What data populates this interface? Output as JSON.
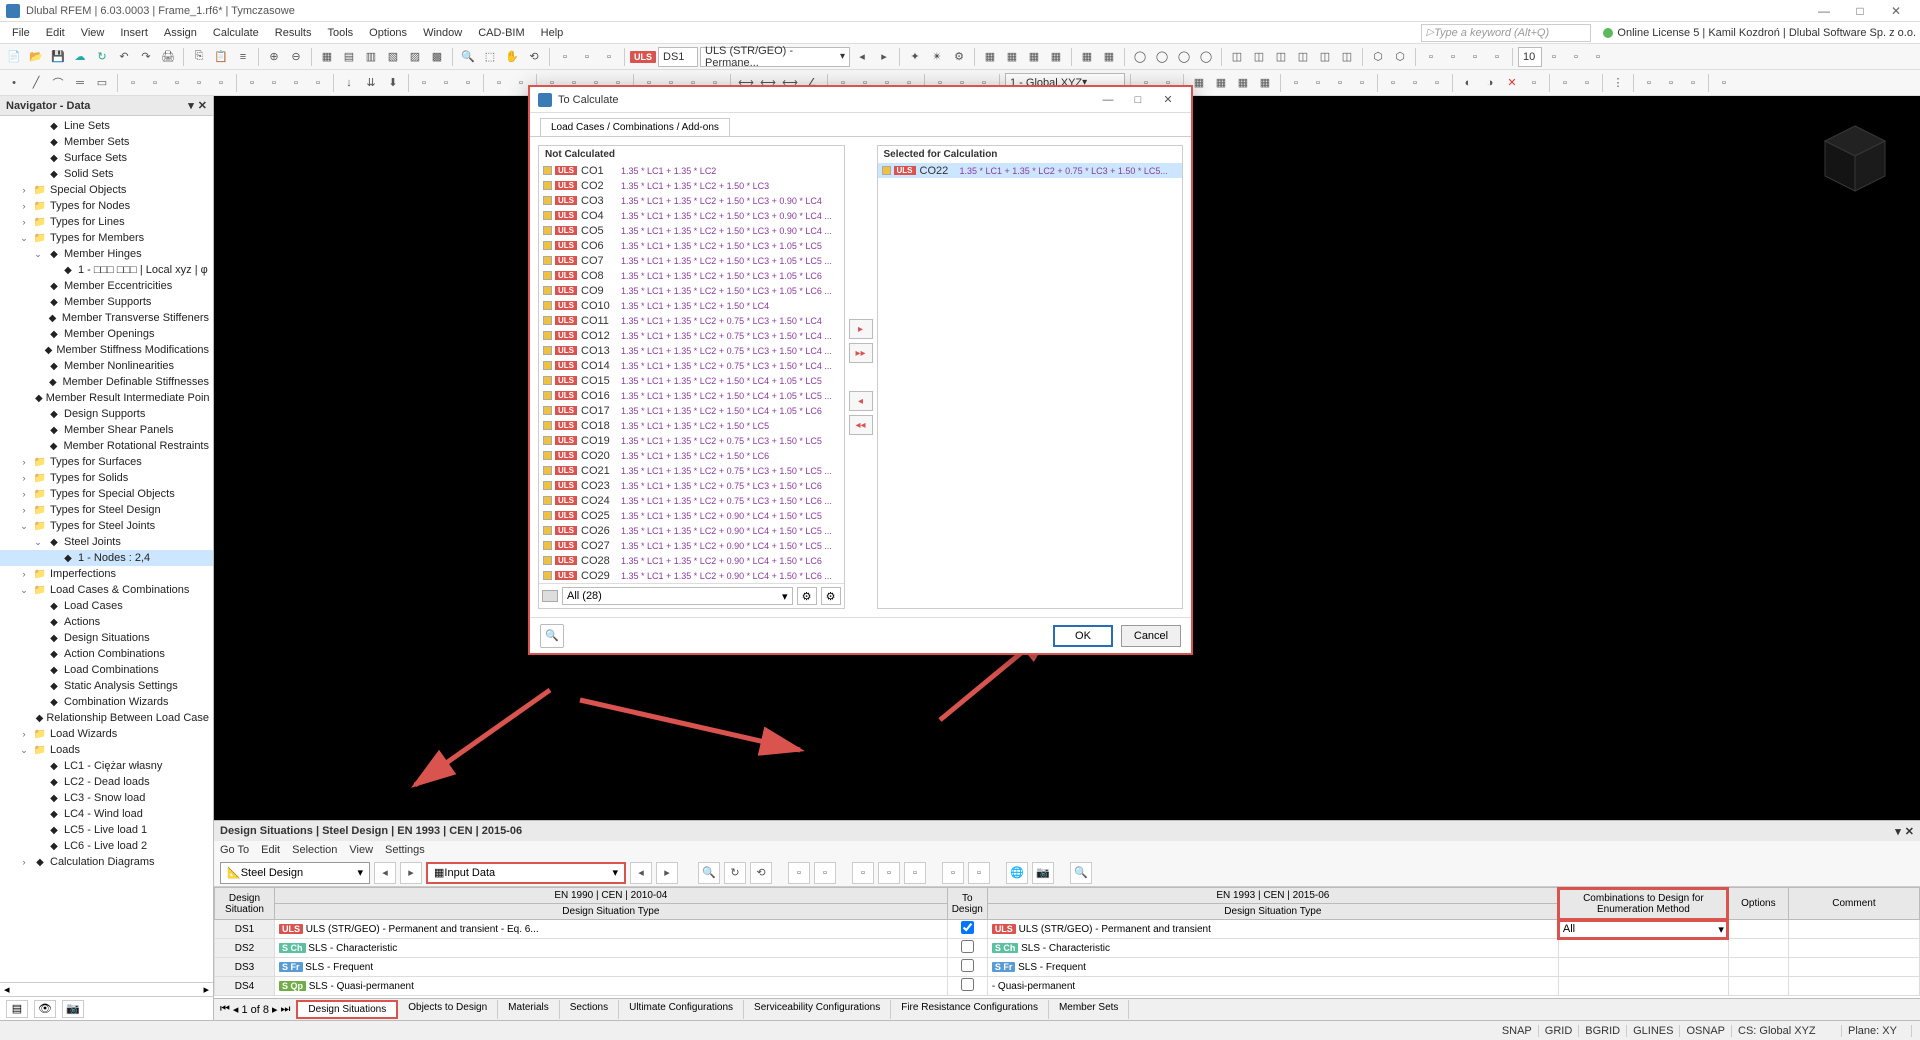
{
  "titlebar": {
    "text": "Dlubal RFEM | 6.03.0003 | Frame_1.rf6* | Tymczasowe",
    "license": "Online License 5 | Kamil Kozdroń | Dlubal Software Sp. z o.o."
  },
  "menubar": {
    "items": [
      "File",
      "Edit",
      "View",
      "Insert",
      "Assign",
      "Calculate",
      "Results",
      "Tools",
      "Options",
      "Window",
      "CAD-BIM",
      "Help"
    ],
    "search_placeholder": "Type a keyword (Alt+Q)"
  },
  "toolbar1": {
    "uls_label": "ULS",
    "ds_label": "DS1",
    "ds_dropdown": "ULS (STR/GEO) - Permane...",
    "number_field": "10"
  },
  "toolbar2": {
    "global_label": "1 - Global XYZ"
  },
  "navigator": {
    "title": "Navigator - Data",
    "items": [
      {
        "level": 2,
        "label": "Line Sets",
        "icon": "line"
      },
      {
        "level": 2,
        "label": "Member Sets",
        "icon": "member"
      },
      {
        "level": 2,
        "label": "Surface Sets",
        "icon": "surface"
      },
      {
        "level": 2,
        "label": "Solid Sets",
        "icon": "solid"
      },
      {
        "level": 1,
        "label": "Special Objects",
        "icon": "folder",
        "toggle": "›"
      },
      {
        "level": 1,
        "label": "Types for Nodes",
        "icon": "folder",
        "toggle": "›"
      },
      {
        "level": 1,
        "label": "Types for Lines",
        "icon": "folder",
        "toggle": "›"
      },
      {
        "level": 1,
        "label": "Types for Members",
        "icon": "folder",
        "toggle": "⌄"
      },
      {
        "level": 2,
        "label": "Member Hinges",
        "icon": "hinge",
        "toggle": "⌄"
      },
      {
        "level": 3,
        "label": "1 - □□□ □□□ | Local xyz | φ"
      },
      {
        "level": 2,
        "label": "Member Eccentricities",
        "icon": "ecc"
      },
      {
        "level": 2,
        "label": "Member Supports",
        "icon": "support"
      },
      {
        "level": 2,
        "label": "Member Transverse Stiffeners",
        "icon": "stiff"
      },
      {
        "level": 2,
        "label": "Member Openings",
        "icon": "open"
      },
      {
        "level": 2,
        "label": "Member Stiffness Modifications",
        "icon": "mod"
      },
      {
        "level": 2,
        "label": "Member Nonlinearities",
        "icon": "nonlin"
      },
      {
        "level": 2,
        "label": "Member Definable Stiffnesses",
        "icon": "defstiff"
      },
      {
        "level": 2,
        "label": "Member Result Intermediate Poin",
        "icon": "point"
      },
      {
        "level": 2,
        "label": "Design Supports",
        "icon": "dsup"
      },
      {
        "level": 2,
        "label": "Member Shear Panels",
        "icon": "shear"
      },
      {
        "level": 2,
        "label": "Member Rotational Restraints",
        "icon": "rot"
      },
      {
        "level": 1,
        "label": "Types for Surfaces",
        "icon": "folder",
        "toggle": "›"
      },
      {
        "level": 1,
        "label": "Types for Solids",
        "icon": "folder",
        "toggle": "›"
      },
      {
        "level": 1,
        "label": "Types for Special Objects",
        "icon": "folder",
        "toggle": "›"
      },
      {
        "level": 1,
        "label": "Types for Steel Design",
        "icon": "folder",
        "toggle": "›"
      },
      {
        "level": 1,
        "label": "Types for Steel Joints",
        "icon": "folder",
        "toggle": "⌄"
      },
      {
        "level": 2,
        "label": "Steel Joints",
        "icon": "joint",
        "toggle": "⌄"
      },
      {
        "level": 3,
        "label": "1 - Nodes : 2,4",
        "selected": true
      },
      {
        "level": 1,
        "label": "Imperfections",
        "icon": "folder",
        "toggle": "›"
      },
      {
        "level": 1,
        "label": "Load Cases & Combinations",
        "icon": "folder",
        "toggle": "⌄"
      },
      {
        "level": 2,
        "label": "Load Cases",
        "icon": "lc"
      },
      {
        "level": 2,
        "label": "Actions",
        "icon": "act"
      },
      {
        "level": 2,
        "label": "Design Situations",
        "icon": "ds"
      },
      {
        "level": 2,
        "label": "Action Combinations",
        "icon": "ac"
      },
      {
        "level": 2,
        "label": "Load Combinations",
        "icon": "lco"
      },
      {
        "level": 2,
        "label": "Static Analysis Settings",
        "icon": "sas"
      },
      {
        "level": 2,
        "label": "Combination Wizards",
        "icon": "cw"
      },
      {
        "level": 2,
        "label": "Relationship Between Load Case",
        "icon": "rel"
      },
      {
        "level": 1,
        "label": "Load Wizards",
        "icon": "folder",
        "toggle": "›"
      },
      {
        "level": 1,
        "label": "Loads",
        "icon": "folder",
        "toggle": "⌄"
      },
      {
        "level": 2,
        "label": "LC1 - Ciężar własny",
        "icon": "lc1"
      },
      {
        "level": 2,
        "label": "LC2 - Dead loads",
        "icon": "lc2"
      },
      {
        "level": 2,
        "label": "LC3 - Snow load",
        "icon": "lc3"
      },
      {
        "level": 2,
        "label": "LC4 - Wind load",
        "icon": "lc4"
      },
      {
        "level": 2,
        "label": "LC5 - Live load 1",
        "icon": "lc5"
      },
      {
        "level": 2,
        "label": "LC6 - Live load 2",
        "icon": "lc6"
      },
      {
        "level": 1,
        "label": "Calculation Diagrams",
        "icon": "calc",
        "toggle": "›"
      }
    ]
  },
  "dialog": {
    "title": "To Calculate",
    "tab": "Load Cases / Combinations / Add-ons",
    "left_header": "Not Calculated",
    "right_header": "Selected for Calculation",
    "filter_text": "All (28)",
    "ok": "OK",
    "cancel": "Cancel",
    "not_calculated": [
      {
        "id": "CO1",
        "formula": "1.35 * LC1 + 1.35 * LC2"
      },
      {
        "id": "CO2",
        "formula": "1.35 * LC1 + 1.35 * LC2 + 1.50 * LC3"
      },
      {
        "id": "CO3",
        "formula": "1.35 * LC1 + 1.35 * LC2 + 1.50 * LC3 + 0.90 * LC4"
      },
      {
        "id": "CO4",
        "formula": "1.35 * LC1 + 1.35 * LC2 + 1.50 * LC3 + 0.90 * LC4 ..."
      },
      {
        "id": "CO5",
        "formula": "1.35 * LC1 + 1.35 * LC2 + 1.50 * LC3 + 0.90 * LC4 ..."
      },
      {
        "id": "CO6",
        "formula": "1.35 * LC1 + 1.35 * LC2 + 1.50 * LC3 + 1.05 * LC5"
      },
      {
        "id": "CO7",
        "formula": "1.35 * LC1 + 1.35 * LC2 + 1.50 * LC3 + 1.05 * LC5 ..."
      },
      {
        "id": "CO8",
        "formula": "1.35 * LC1 + 1.35 * LC2 + 1.50 * LC3 + 1.05 * LC6"
      },
      {
        "id": "CO9",
        "formula": "1.35 * LC1 + 1.35 * LC2 + 1.50 * LC3 + 1.05 * LC6 ..."
      },
      {
        "id": "CO10",
        "formula": "1.35 * LC1 + 1.35 * LC2 + 1.50 * LC4"
      },
      {
        "id": "CO11",
        "formula": "1.35 * LC1 + 1.35 * LC2 + 0.75 * LC3 + 1.50 * LC4"
      },
      {
        "id": "CO12",
        "formula": "1.35 * LC1 + 1.35 * LC2 + 0.75 * LC3 + 1.50 * LC4 ..."
      },
      {
        "id": "CO13",
        "formula": "1.35 * LC1 + 1.35 * LC2 + 0.75 * LC3 + 1.50 * LC4 ..."
      },
      {
        "id": "CO14",
        "formula": "1.35 * LC1 + 1.35 * LC2 + 0.75 * LC3 + 1.50 * LC4 ..."
      },
      {
        "id": "CO15",
        "formula": "1.35 * LC1 + 1.35 * LC2 + 1.50 * LC4 + 1.05 * LC5"
      },
      {
        "id": "CO16",
        "formula": "1.35 * LC1 + 1.35 * LC2 + 1.50 * LC4 + 1.05 * LC5 ..."
      },
      {
        "id": "CO17",
        "formula": "1.35 * LC1 + 1.35 * LC2 + 1.50 * LC4 + 1.05 * LC6"
      },
      {
        "id": "CO18",
        "formula": "1.35 * LC1 + 1.35 * LC2 + 1.50 * LC5"
      },
      {
        "id": "CO19",
        "formula": "1.35 * LC1 + 1.35 * LC2 + 0.75 * LC3 + 1.50 * LC5"
      },
      {
        "id": "CO20",
        "formula": "1.35 * LC1 + 1.35 * LC2 + 1.50 * LC6"
      },
      {
        "id": "CO21",
        "formula": "1.35 * LC1 + 1.35 * LC2 + 0.75 * LC3 + 1.50 * LC5 ..."
      },
      {
        "id": "CO23",
        "formula": "1.35 * LC1 + 1.35 * LC2 + 0.75 * LC3 + 1.50 * LC6"
      },
      {
        "id": "CO24",
        "formula": "1.35 * LC1 + 1.35 * LC2 + 0.75 * LC3 + 1.50 * LC6 ..."
      },
      {
        "id": "CO25",
        "formula": "1.35 * LC1 + 1.35 * LC2 + 0.90 * LC4 + 1.50 * LC5"
      },
      {
        "id": "CO26",
        "formula": "1.35 * LC1 + 1.35 * LC2 + 0.90 * LC4 + 1.50 * LC5 ..."
      },
      {
        "id": "CO27",
        "formula": "1.35 * LC1 + 1.35 * LC2 + 0.90 * LC4 + 1.50 * LC5 ..."
      },
      {
        "id": "CO28",
        "formula": "1.35 * LC1 + 1.35 * LC2 + 0.90 * LC4 + 1.50 * LC6"
      },
      {
        "id": "CO29",
        "formula": "1.35 * LC1 + 1.35 * LC2 + 0.90 * LC4 + 1.50 * LC6 ..."
      }
    ],
    "selected": [
      {
        "id": "CO22",
        "formula": "1.35 * LC1 + 1.35 * LC2 + 0.75 * LC3 + 1.50 * LC5..."
      }
    ]
  },
  "bottom_panel": {
    "title": "Design Situations | Steel Design | EN 1993 | CEN | 2015-06",
    "menu": [
      "Go To",
      "Edit",
      "Selection",
      "View",
      "Settings"
    ],
    "combo1": "Steel Design",
    "combo2": "Input Data",
    "page_info": "1 of 8",
    "headers": {
      "col_a": "Design\nSituation",
      "col_b_top": "EN 1990 | CEN | 2010-04",
      "col_b": "Design Situation Type",
      "col_c": "To\nDesign",
      "col_d_top": "EN 1993 | CEN | 2015-06",
      "col_d": "Design Situation Type",
      "col_e": "Combinations to Design\nfor Enumeration Method",
      "col_f": "Options",
      "col_g": "Comment"
    },
    "rows": [
      {
        "ds": "DS1",
        "badge": "ULS",
        "bclass": "uls",
        "type1": "ULS (STR/GEO) - Permanent and transient - Eq. 6...",
        "check": true,
        "badge2": "ULS",
        "bclass2": "uls",
        "type2": "ULS (STR/GEO) - Permanent and transient",
        "combo": "All"
      },
      {
        "ds": "DS2",
        "badge": "S Ch",
        "bclass": "sch",
        "type1": "SLS - Characteristic",
        "check": false,
        "badge2": "S Ch",
        "bclass2": "sch",
        "type2": "SLS - Characteristic",
        "combo": ""
      },
      {
        "ds": "DS3",
        "badge": "S Fr",
        "bclass": "sfr",
        "type1": "SLS - Frequent",
        "check": false,
        "badge2": "S Fr",
        "bclass2": "sfr",
        "type2": "SLS - Frequent",
        "combo": ""
      },
      {
        "ds": "DS4",
        "badge": "S Qp",
        "bclass": "sqp",
        "type1": "SLS - Quasi-permanent",
        "check": false,
        "badge2": "",
        "bclass2": "",
        "type2": "- Quasi-permanent",
        "combo": ""
      }
    ],
    "tabs": [
      "Design Situations",
      "Objects to Design",
      "Materials",
      "Sections",
      "Ultimate Configurations",
      "Serviceability Configurations",
      "Fire Resistance Configurations",
      "Member Sets"
    ]
  },
  "statusbar": {
    "items": [
      "SNAP",
      "GRID",
      "BGRID",
      "GLINES",
      "OSNAP"
    ],
    "cs": "CS: Global XYZ",
    "plane": "Plane: XY"
  }
}
